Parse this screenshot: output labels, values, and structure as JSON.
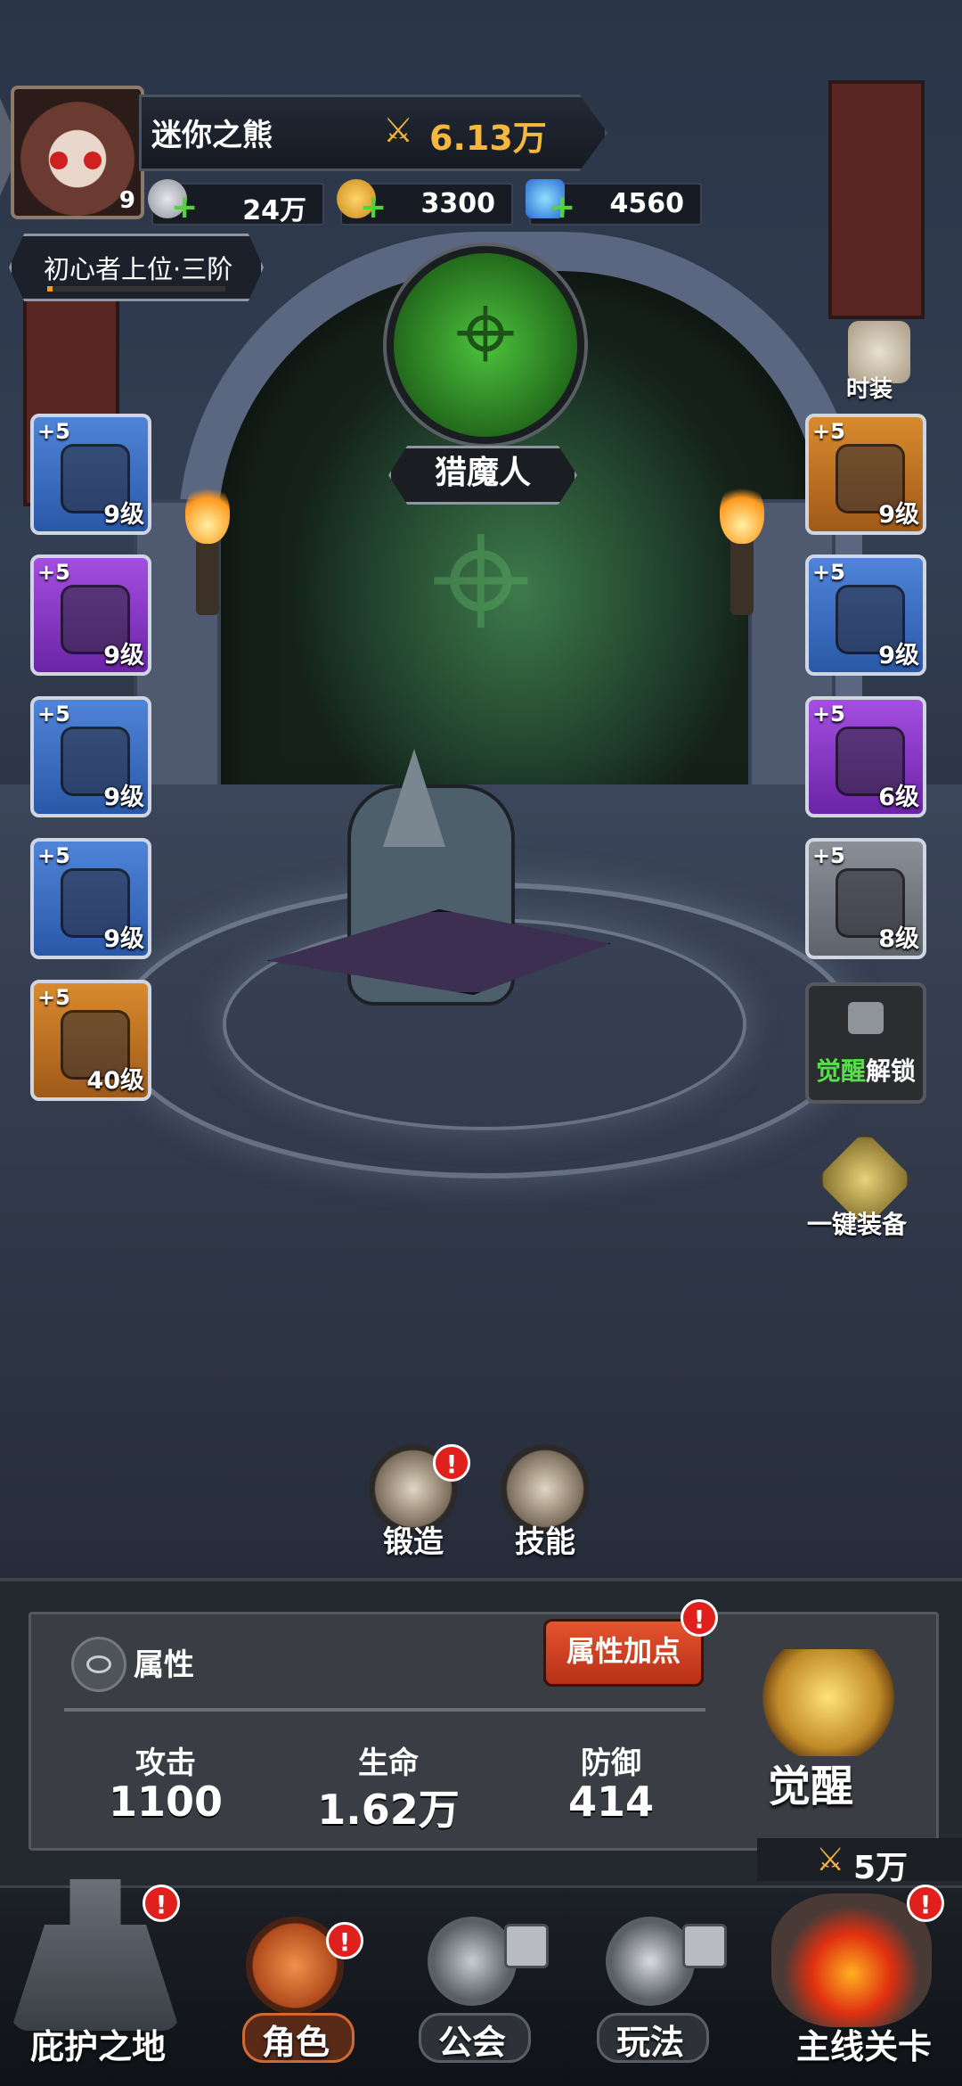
{
  "player": {
    "name": "迷你之熊",
    "level": "9",
    "power": "6.13万",
    "rank": "初心者上位·三阶"
  },
  "resources": [
    {
      "icon": "silver-coin-icon",
      "value": "24万"
    },
    {
      "icon": "gold-coin-icon",
      "value": "3300"
    },
    {
      "icon": "blue-gem-icon",
      "value": "4560"
    }
  ],
  "hero_class": {
    "name": "猎魔人",
    "icon": "crossbow-emblem-icon"
  },
  "costume_label": "时装",
  "left_slots": [
    {
      "plus": "+5",
      "level": "9级",
      "rarity": "blue",
      "icon": "hood-helmet-icon"
    },
    {
      "plus": "+5",
      "level": "9级",
      "rarity": "purple",
      "icon": "spiked-shoulder-icon"
    },
    {
      "plus": "+5",
      "level": "9级",
      "rarity": "blue",
      "icon": "gauntlet-icon"
    },
    {
      "plus": "+5",
      "level": "9级",
      "rarity": "blue",
      "icon": "pants-icon"
    },
    {
      "plus": "+5",
      "level": "40级",
      "rarity": "orange",
      "icon": "crossbow-weapon-icon"
    }
  ],
  "right_slots": [
    {
      "plus": "+5",
      "level": "9级",
      "rarity": "orange",
      "icon": "armor-icon"
    },
    {
      "plus": "+5",
      "level": "9级",
      "rarity": "blue",
      "icon": "bracer-icon"
    },
    {
      "plus": "+5",
      "level": "6级",
      "rarity": "purple",
      "icon": "belt-icon"
    },
    {
      "plus": "+5",
      "level": "8级",
      "rarity": "gray",
      "icon": "boots-icon"
    }
  ],
  "awaken_unlock": {
    "highlight": "觉醒",
    "rest": "解锁"
  },
  "one_key_equip": "一键装备",
  "actions": {
    "forge": "锻造",
    "skill": "技能",
    "badge": "!"
  },
  "attributes": {
    "title": "属性",
    "add_points": "属性加点",
    "stats": [
      {
        "label": "攻击",
        "value": "1100"
      },
      {
        "label": "生命",
        "value": "1.62万"
      },
      {
        "label": "防御",
        "value": "414"
      }
    ],
    "awaken": "觉醒",
    "awaken_power": "5万"
  },
  "nav": {
    "shelter": "庇护之地",
    "character": "角色",
    "guild": "公会",
    "gameplay": "玩法",
    "main_stage": "主线关卡"
  },
  "colors": {
    "power": "#f7b63c",
    "badge": "#e0201c",
    "green": "#57e04a"
  }
}
